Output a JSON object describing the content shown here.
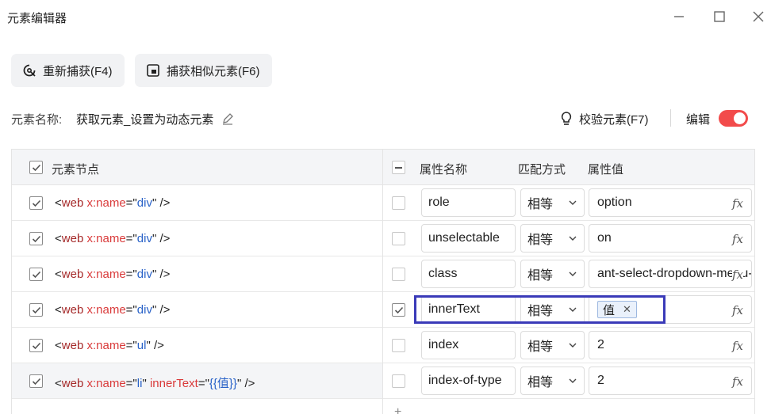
{
  "window": {
    "title": "元素编辑器"
  },
  "toolbar": {
    "recapture_label": "重新捕获(F4)",
    "capture_similar_label": "捕获相似元素(F6)"
  },
  "element": {
    "name_label": "元素名称:",
    "name_value": "获取元素_设置为动态元素",
    "verify_label": "校验元素(F7)",
    "edit_label": "编辑",
    "edit_enabled": true
  },
  "table": {
    "headers": {
      "node": "元素节点",
      "attr_name": "属性名称",
      "match": "匹配方式",
      "attr_value": "属性值"
    },
    "fx_symbol": "fx",
    "rows": [
      {
        "node_tag": "web",
        "node_attr": "x:name",
        "node_val": "div",
        "extra_attr": "",
        "extra_val": "",
        "node_checked": true,
        "attr_checked": false,
        "attr_name": "role",
        "match": "相等",
        "value": "option",
        "chip": ""
      },
      {
        "node_tag": "web",
        "node_attr": "x:name",
        "node_val": "div",
        "extra_attr": "",
        "extra_val": "",
        "node_checked": true,
        "attr_checked": false,
        "attr_name": "unselectable",
        "match": "相等",
        "value": "on",
        "chip": ""
      },
      {
        "node_tag": "web",
        "node_attr": "x:name",
        "node_val": "div",
        "extra_attr": "",
        "extra_val": "",
        "node_checked": true,
        "attr_checked": false,
        "attr_name": "class",
        "match": "相等",
        "value": "ant-select-dropdown-menu-item",
        "chip": ""
      },
      {
        "node_tag": "web",
        "node_attr": "x:name",
        "node_val": "div",
        "extra_attr": "",
        "extra_val": "",
        "node_checked": true,
        "attr_checked": true,
        "attr_name": "innerText",
        "match": "相等",
        "value": "",
        "chip": "值"
      },
      {
        "node_tag": "web",
        "node_attr": "x:name",
        "node_val": "ul",
        "extra_attr": "",
        "extra_val": "",
        "node_checked": true,
        "attr_checked": false,
        "attr_name": "index",
        "match": "相等",
        "value": "2",
        "chip": ""
      },
      {
        "node_tag": "web",
        "node_attr": "x:name",
        "node_val": "li",
        "extra_attr": "innerText",
        "extra_val": "{{值}}",
        "node_checked": true,
        "attr_checked": false,
        "attr_name": "index-of-type",
        "match": "相等",
        "value": "2",
        "chip": ""
      }
    ],
    "add_symbol": "+"
  },
  "colors": {
    "toggle_on": "#f24b4b",
    "focus_border": "#3a3ab8",
    "tag": "#a52a2a",
    "attr": "#d93a3a",
    "value": "#2962c8"
  }
}
